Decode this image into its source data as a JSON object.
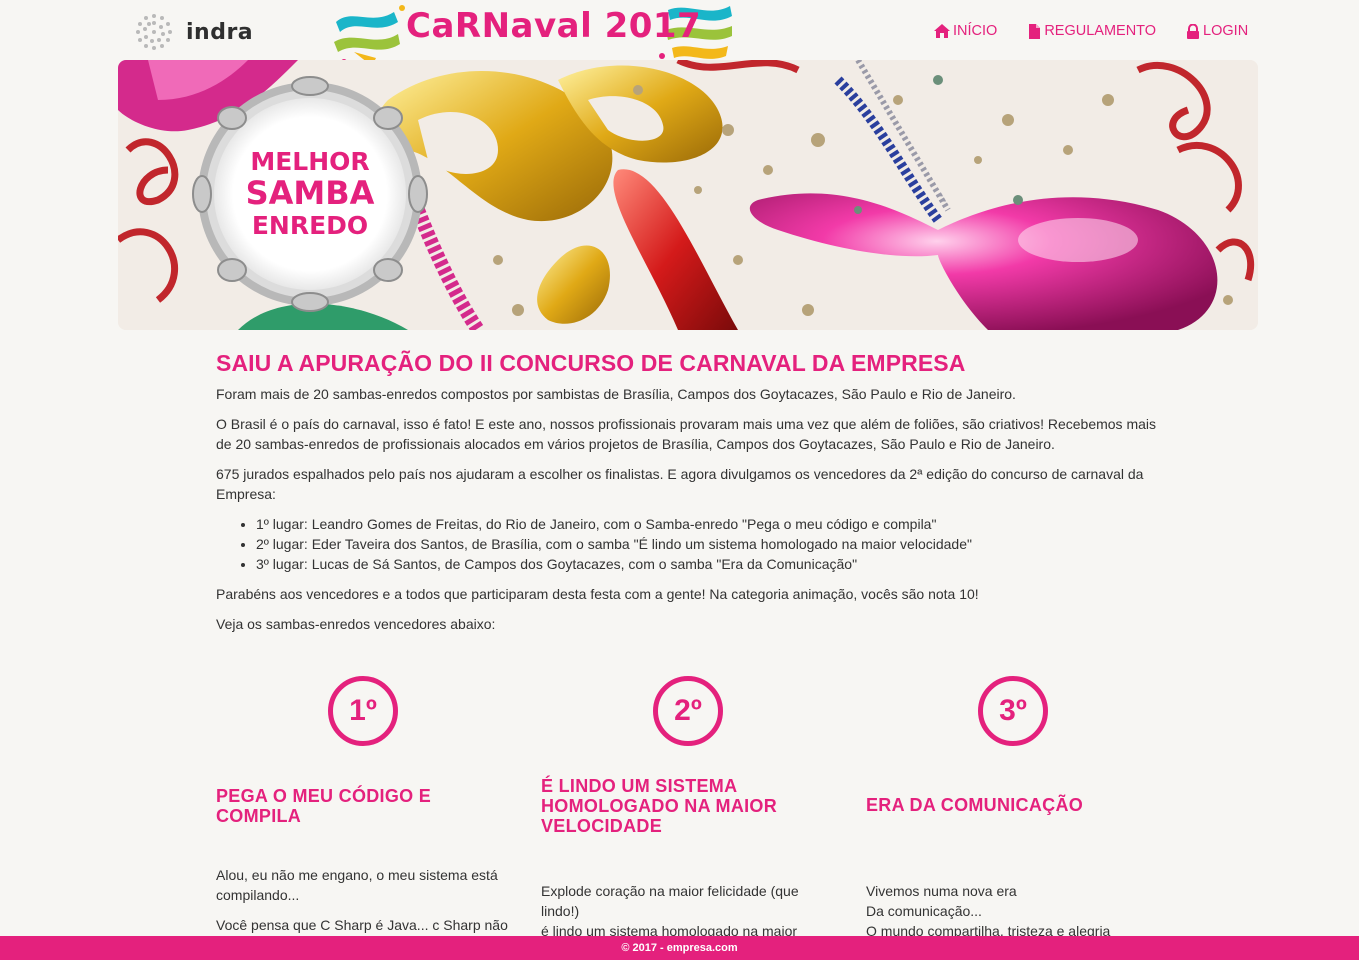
{
  "header": {
    "brand": "indra",
    "event_logo": "CaRNaval 2017",
    "nav": [
      {
        "label": "INÍCIO",
        "icon": "home-icon"
      },
      {
        "label": "REGULAMENTO",
        "icon": "document-icon"
      },
      {
        "label": "LOGIN",
        "icon": "lock-icon"
      }
    ]
  },
  "banner": {
    "line1": "MELHOR",
    "line2": "SAMBA",
    "line3": "ENREDO"
  },
  "article": {
    "headline": "SAIU A APURAÇÃO DO II CONCURSO DE CARNAVAL DA EMPRESA",
    "p1": "Foram mais de 20 sambas-enredos compostos por sambistas de Brasília, Campos dos Goytacazes, São Paulo e Rio de Janeiro.",
    "p2": "O Brasil é o país do carnaval, isso é fato! E este ano, nossos profissionais provaram mais uma vez que além de foliões, são criativos! Recebemos mais de 20 sambas-enredos de profissionais alocados em vários projetos de Brasília, Campos dos Goytacazes, São Paulo e Rio de Janeiro.",
    "p3": "675 jurados espalhados pelo país nos ajudaram a escolher os finalistas. E agora divulgamos os vencedores da 2ª edição do concurso de carnaval da Empresa:",
    "list": [
      "1º lugar: Leandro Gomes de Freitas, do Rio de Janeiro, com o Samba-enredo \"Pega o meu código e compila\"",
      "2º lugar: Eder Taveira dos Santos, de Brasília, com o samba \"É lindo um sistema homologado na maior velocidade\"",
      "3º lugar: Lucas de Sá Santos, de Campos dos Goytacazes, com o samba \"Era da Comunicação\""
    ],
    "p4": "Parabéns aos vencedores e a todos que participaram desta festa com a gente! Na categoria animação, vocês são nota 10!",
    "p5": "Veja os sambas-enredos vencedores abaixo:"
  },
  "winners": [
    {
      "rank": "1º",
      "title": "PEGA O MEU CÓDIGO E COMPILA",
      "lyrics_p1": "Alou, eu não me engano, o meu sistema está compilando...",
      "lyrics_p2": "Você pensa que C Sharp é Java... c Sharp não"
    },
    {
      "rank": "2º",
      "title": "É LINDO UM SISTEMA HOMOLOGADO NA MAIOR VELOCIDADE",
      "lyrics_p1": "Explode coração na maior felicidade (que lindo!)\né lindo um sistema homologado na maior velocidade. (Explode!)",
      "lyrics_p2": ""
    },
    {
      "rank": "3º",
      "title": "ERA DA COMUNICAÇÃO",
      "lyrics_p1": "Vivemos numa nova era\nDa comunicação...\nO mundo compartilha, tristeza e alegria\nUm monte de informação",
      "lyrics_p2": ""
    }
  ],
  "footer": {
    "text": "© 2017 - empresa.com"
  },
  "colors": {
    "accent": "#e4217d",
    "background": "#f7f6f3",
    "text": "#333333"
  }
}
